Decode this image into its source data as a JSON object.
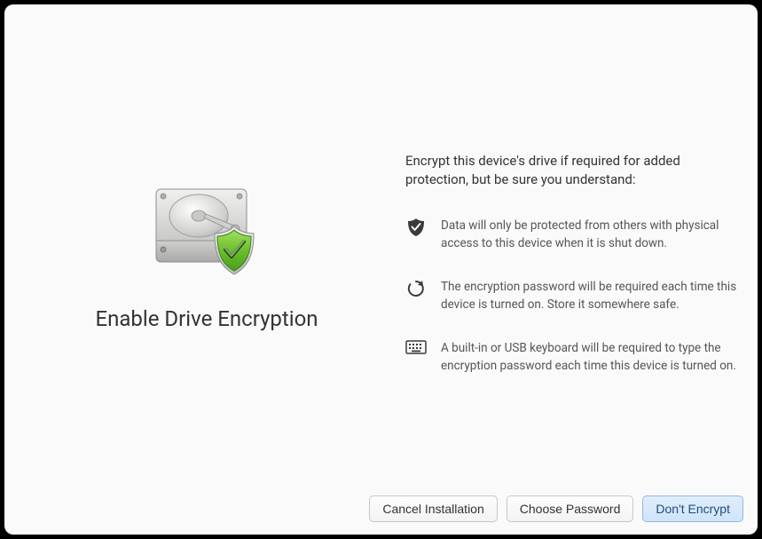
{
  "title": "Enable Drive Encryption",
  "intro": "Encrypt this device's drive if required for added protection, but be sure you understand:",
  "items": [
    {
      "text": "Data will only be protected from others with physical access to this device when it is shut down."
    },
    {
      "text": "The encryption password will be required each time this device is turned on. Store it somewhere safe."
    },
    {
      "text": "A built-in or USB keyboard will be required to type the encryption password each time this device is turned on."
    }
  ],
  "buttons": {
    "cancel": "Cancel Installation",
    "choose": "Choose Password",
    "dont": "Don't Encrypt"
  }
}
